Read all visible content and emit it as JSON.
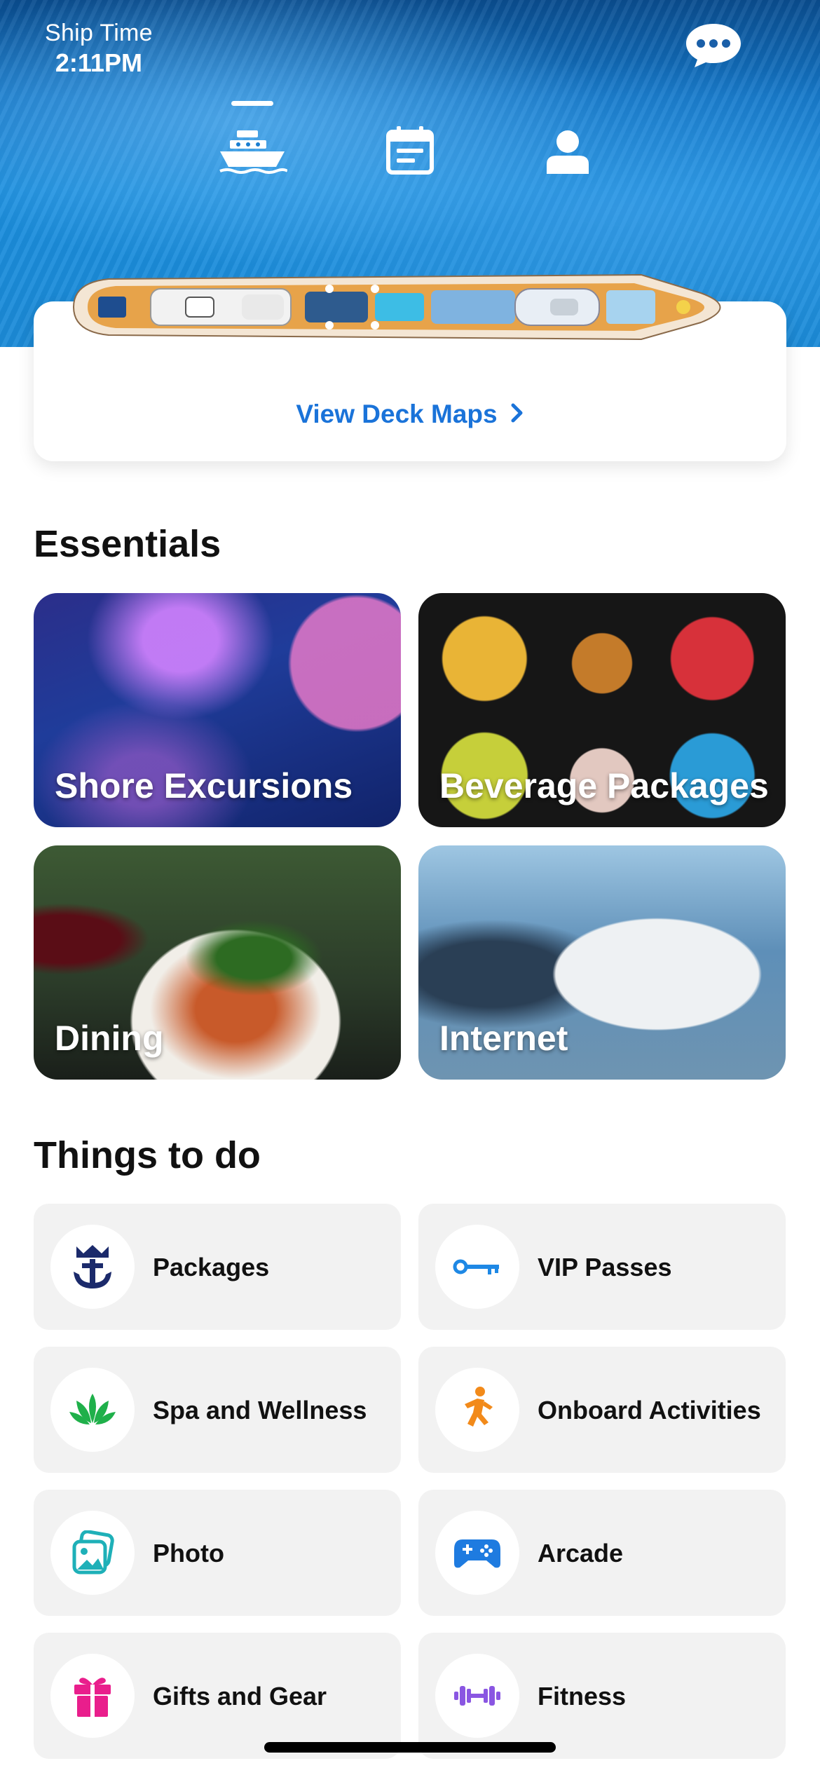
{
  "status": {
    "label": "Ship Time",
    "time": "2:11PM"
  },
  "top_nav": [
    {
      "name": "ship",
      "icon": "ship-icon",
      "active": true
    },
    {
      "name": "calendar",
      "icon": "calendar-icon",
      "active": false
    },
    {
      "name": "profile",
      "icon": "profile-icon",
      "active": false
    }
  ],
  "deck": {
    "link_label": "View Deck Maps"
  },
  "essentials": {
    "title": "Essentials",
    "tiles": [
      {
        "label": "Shore Excursions"
      },
      {
        "label": "Beverage Packages"
      },
      {
        "label": "Dining"
      },
      {
        "label": "Internet"
      }
    ]
  },
  "things_to_do": {
    "title": "Things to do",
    "items": [
      {
        "label": "Packages",
        "icon": "anchor-crown-icon",
        "color": "#1b2a6b"
      },
      {
        "label": "VIP Passes",
        "icon": "key-icon",
        "color": "#1e88e5"
      },
      {
        "label": "Spa and Wellness",
        "icon": "lotus-icon",
        "color": "#1fb04a"
      },
      {
        "label": "Onboard Activities",
        "icon": "running-person-icon",
        "color": "#f28a1a"
      },
      {
        "label": "Photo",
        "icon": "photo-icon",
        "color": "#1eb0b8"
      },
      {
        "label": "Arcade",
        "icon": "gamepad-icon",
        "color": "#1e7be0"
      },
      {
        "label": "Gifts and Gear",
        "icon": "gift-icon",
        "color": "#e91e8c"
      },
      {
        "label": "Fitness",
        "icon": "dumbbell-icon",
        "color": "#8a56e2"
      }
    ]
  },
  "colors": {
    "accent_link": "#1a73d9",
    "tile_bg": "#f2f2f2"
  }
}
